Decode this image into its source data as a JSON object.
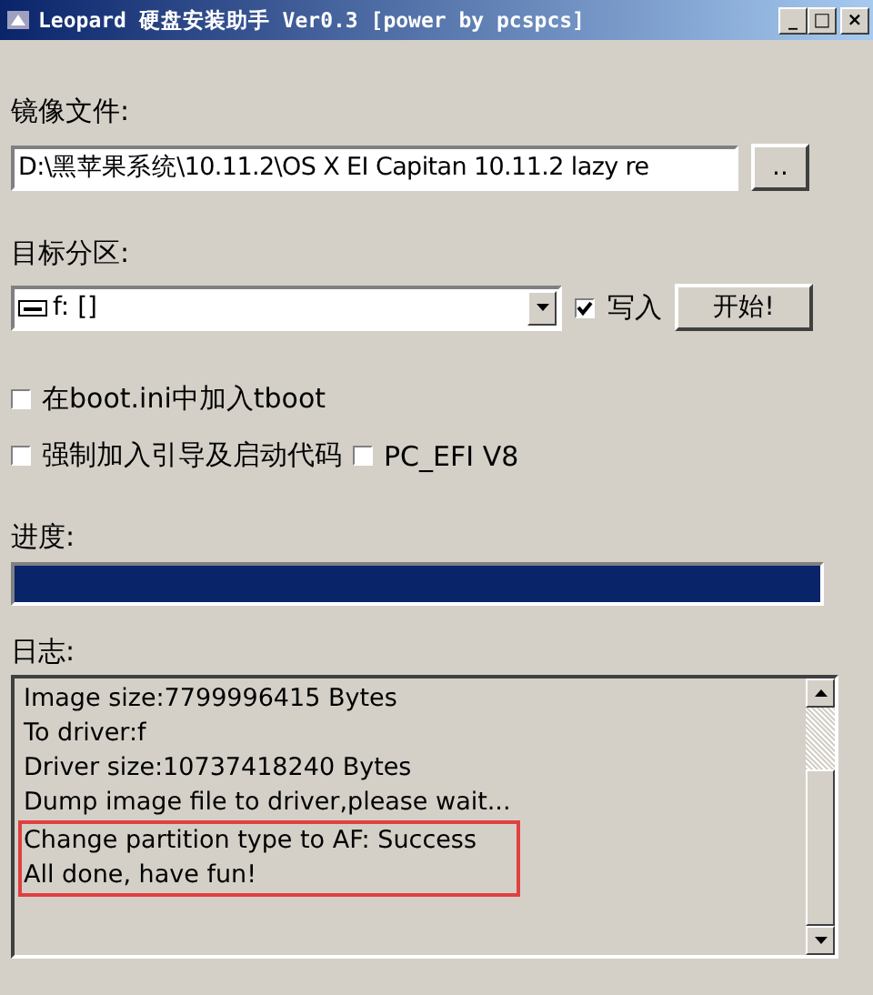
{
  "window": {
    "title": "Leopard 硬盘安装助手 Ver0.3 [power by pcspcs]",
    "controls": [
      "_",
      "□",
      "×"
    ]
  },
  "image_file": {
    "label": "镜像文件:",
    "value": "D:\\黑苹果系统\\10.11.2\\OS X EI Capitan 10.11.2 lazy re",
    "browse_button": ".."
  },
  "target_partition": {
    "label": "目标分区:",
    "value": "f: []",
    "write": {
      "label": "写入",
      "checked": true
    },
    "start_button": "开始!"
  },
  "options": [
    {
      "label": "在boot.ini中加入tboot",
      "checked": false
    },
    {
      "label": "强制加入引导及启动代码",
      "checked": false
    },
    {
      "label": "PC_EFI V8",
      "checked": false
    }
  ],
  "progress": {
    "label": "进度:",
    "level": 1
  },
  "log": {
    "label": "日志:",
    "lines": [
      {
        "text": "Image size:7799996415 Bytes",
        "highlighted": false
      },
      {
        "text": "To driver:f",
        "highlighted": false
      },
      {
        "text": "Driver size:10737418240 Bytes",
        "highlighted": false
      },
      {
        "text": "Dump image file to driver,please wait...",
        "highlighted": false
      },
      {
        "text": "Change partition type to AF: Success",
        "highlighted": true
      },
      {
        "text": "All done, have fun!",
        "highlighted": true
      }
    ]
  }
}
